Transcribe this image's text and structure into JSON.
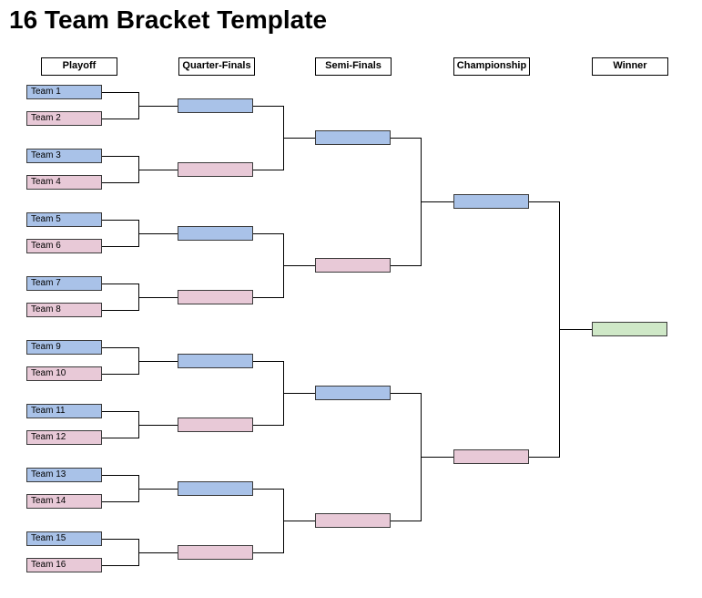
{
  "title": "16 Team Bracket Template",
  "headers": {
    "playoff": "Playoff",
    "qf": "Quarter-Finals",
    "sf": "Semi-Finals",
    "ch": "Championship",
    "wn": "Winner"
  },
  "r1": [
    "Team 1",
    "Team 2",
    "Team 3",
    "Team 4",
    "Team 5",
    "Team 6",
    "Team 7",
    "Team 8",
    "Team 9",
    "Team 10",
    "Team 11",
    "Team 12",
    "Team 13",
    "Team 14",
    "Team 15",
    "Team 16"
  ],
  "r2": [
    "",
    "",
    "",
    "",
    "",
    "",
    "",
    ""
  ],
  "r3": [
    "",
    "",
    "",
    ""
  ],
  "r4": [
    "",
    ""
  ],
  "r5": [
    ""
  ]
}
